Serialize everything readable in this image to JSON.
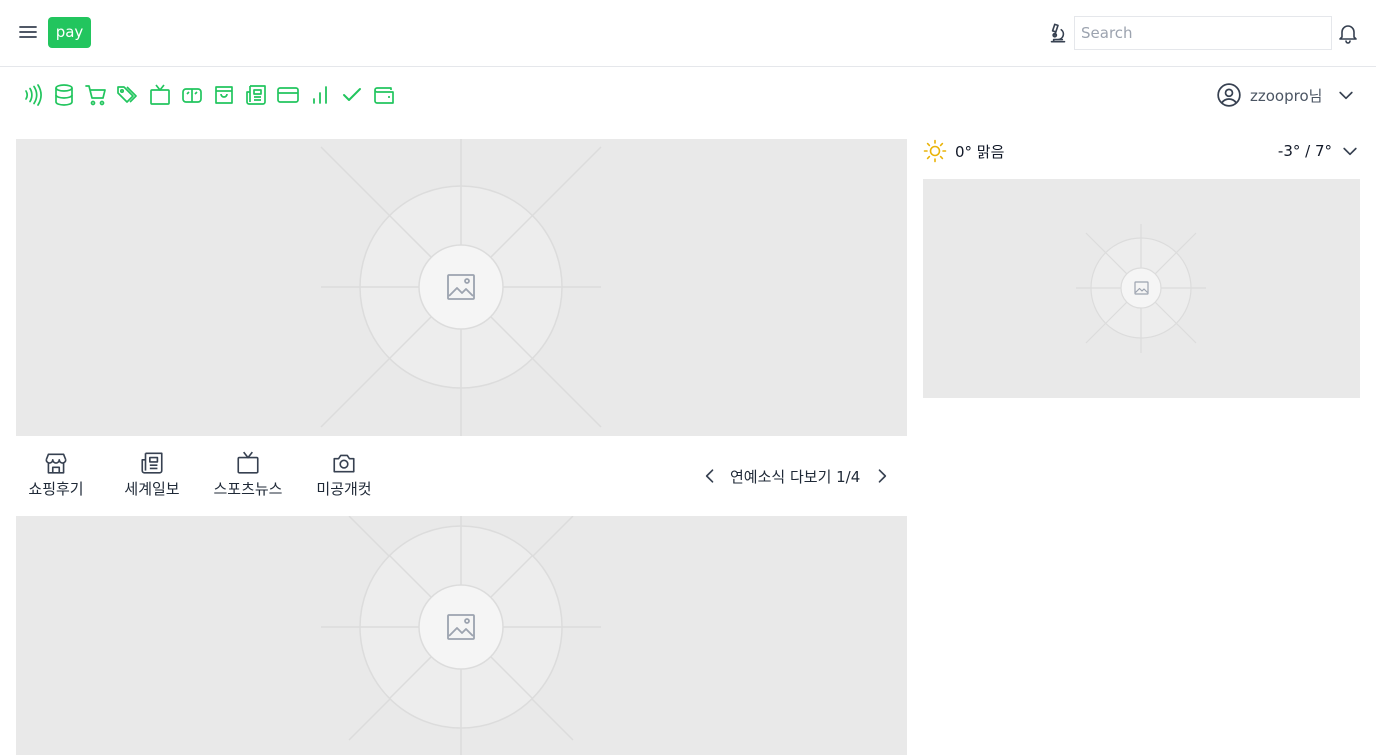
{
  "header": {
    "logo_text": "pay",
    "search_placeholder": "Search"
  },
  "quick_icons": [
    "nfc-icon",
    "database-icon",
    "cart-icon",
    "tags-icon",
    "tv-icon",
    "ticket-icon",
    "shopping-bag-icon",
    "newspaper-icon",
    "credit-card-icon",
    "bar-chart-icon",
    "check-icon",
    "wallet-icon"
  ],
  "user": {
    "name": "zzoopro님"
  },
  "categories": [
    {
      "label": "쇼핑후기",
      "icon": "store-icon"
    },
    {
      "label": "세계일보",
      "icon": "newspaper-icon"
    },
    {
      "label": "스포츠뉴스",
      "icon": "tv-icon"
    },
    {
      "label": "미공개컷",
      "icon": "camera-icon"
    }
  ],
  "pager": {
    "label": "연예소식 다보기 1/4"
  },
  "weather": {
    "current": "0° 맑음",
    "range": "-3° / 7°"
  },
  "colors": {
    "accent": "#22c55e",
    "placeholder_bg": "#e9e9e9",
    "sun": "#eab308"
  }
}
